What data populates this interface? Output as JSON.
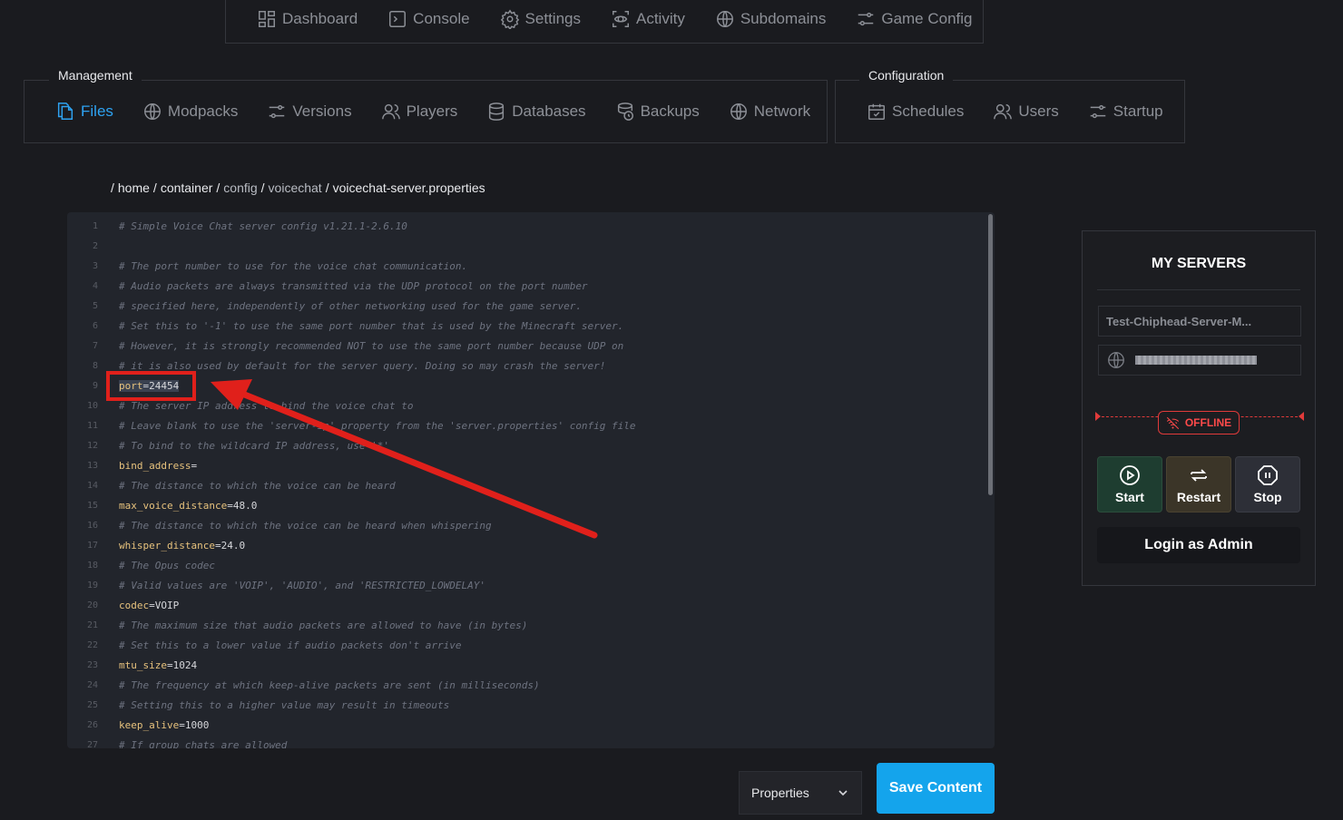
{
  "top_nav": {
    "items": [
      {
        "label": "Dashboard",
        "icon": "dashboard-icon"
      },
      {
        "label": "Console",
        "icon": "console-icon"
      },
      {
        "label": "Settings",
        "icon": "gear-icon"
      },
      {
        "label": "Activity",
        "icon": "activity-icon"
      },
      {
        "label": "Subdomains",
        "icon": "globe-icon"
      },
      {
        "label": "Game Config",
        "icon": "sliders-icon"
      }
    ]
  },
  "management": {
    "label": "Management",
    "items": [
      {
        "label": "Files",
        "icon": "file-icon",
        "active": true
      },
      {
        "label": "Modpacks",
        "icon": "globe-icon"
      },
      {
        "label": "Versions",
        "icon": "sliders-icon"
      },
      {
        "label": "Players",
        "icon": "users-icon"
      },
      {
        "label": "Databases",
        "icon": "database-icon"
      },
      {
        "label": "Backups",
        "icon": "backup-icon"
      },
      {
        "label": "Network",
        "icon": "globe-icon"
      }
    ]
  },
  "configuration": {
    "label": "Configuration",
    "items": [
      {
        "label": "Schedules",
        "icon": "calendar-icon"
      },
      {
        "label": "Users",
        "icon": "users-icon"
      },
      {
        "label": "Startup",
        "icon": "sliders-icon"
      }
    ]
  },
  "breadcrumb": {
    "parts": [
      "home",
      "container",
      "config",
      "voicechat",
      "voicechat-server.properties"
    ]
  },
  "editor": {
    "lines": [
      {
        "n": "1",
        "type": "comment",
        "text": "# Simple Voice Chat server config v1.21.1-2.6.10"
      },
      {
        "n": "2",
        "type": "blank",
        "text": ""
      },
      {
        "n": "3",
        "type": "comment",
        "text": "# The port number to use for the voice chat communication."
      },
      {
        "n": "4",
        "type": "comment",
        "text": "# Audio packets are always transmitted via the UDP protocol on the port number"
      },
      {
        "n": "5",
        "type": "comment",
        "text": "# specified here, independently of other networking used for the game server."
      },
      {
        "n": "6",
        "type": "comment",
        "text": "# Set this to '-1' to use the same port number that is used by the Minecraft server."
      },
      {
        "n": "7",
        "type": "comment",
        "text": "# However, it is strongly recommended NOT to use the same port number because UDP on"
      },
      {
        "n": "8",
        "type": "comment",
        "text": "# it is also used by default for the server query. Doing so may crash the server!"
      },
      {
        "n": "9",
        "type": "kv",
        "key": "port",
        "value": "24454",
        "highlight": true
      },
      {
        "n": "10",
        "type": "comment",
        "text": "# The server IP address to bind the voice chat to"
      },
      {
        "n": "11",
        "type": "comment",
        "text": "# Leave blank to use the 'server-ip' property from the 'server.properties' config file"
      },
      {
        "n": "12",
        "type": "comment",
        "text": "# To bind to the wildcard IP address, use '*'"
      },
      {
        "n": "13",
        "type": "kv",
        "key": "bind_address",
        "value": ""
      },
      {
        "n": "14",
        "type": "comment",
        "text": "# The distance to which the voice can be heard"
      },
      {
        "n": "15",
        "type": "kv",
        "key": "max_voice_distance",
        "value": "48.0"
      },
      {
        "n": "16",
        "type": "comment",
        "text": "# The distance to which the voice can be heard when whispering"
      },
      {
        "n": "17",
        "type": "kv",
        "key": "whisper_distance",
        "value": "24.0"
      },
      {
        "n": "18",
        "type": "comment",
        "text": "# The Opus codec"
      },
      {
        "n": "19",
        "type": "comment",
        "text": "# Valid values are 'VOIP', 'AUDIO', and 'RESTRICTED_LOWDELAY'"
      },
      {
        "n": "20",
        "type": "kv",
        "key": "codec",
        "value": "VOIP"
      },
      {
        "n": "21",
        "type": "comment",
        "text": "# The maximum size that audio packets are allowed to have (in bytes)"
      },
      {
        "n": "22",
        "type": "comment",
        "text": "# Set this to a lower value if audio packets don't arrive"
      },
      {
        "n": "23",
        "type": "kv",
        "key": "mtu_size",
        "value": "1024"
      },
      {
        "n": "24",
        "type": "comment",
        "text": "# The frequency at which keep-alive packets are sent (in milliseconds)"
      },
      {
        "n": "25",
        "type": "comment",
        "text": "# Setting this to a higher value may result in timeouts"
      },
      {
        "n": "26",
        "type": "kv",
        "key": "keep_alive",
        "value": "1000"
      },
      {
        "n": "27",
        "type": "comment",
        "text": "# If group chats are allowed"
      }
    ]
  },
  "footer": {
    "mode_select": "Properties",
    "save_label": "Save Content"
  },
  "servers_panel": {
    "title": "MY SERVERS",
    "server_name": "Test-Chiphead-Server-M...",
    "status": "OFFLINE",
    "buttons": {
      "start": "Start",
      "restart": "Restart",
      "stop": "Stop"
    },
    "login_label": "Login as Admin"
  },
  "colors": {
    "accent": "#14a4ec",
    "offline": "#ff4a4a",
    "annotation": "#e0201b"
  }
}
